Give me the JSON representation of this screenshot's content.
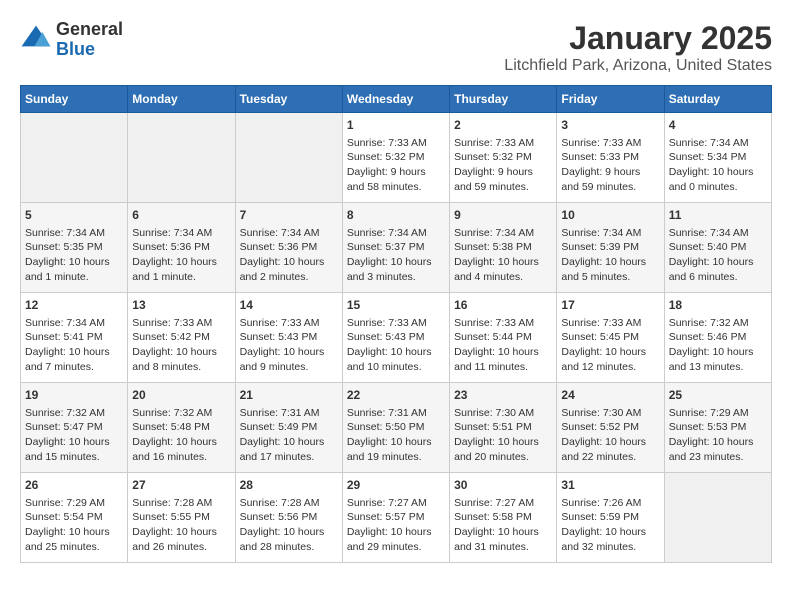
{
  "logo": {
    "general": "General",
    "blue": "Blue"
  },
  "title": "January 2025",
  "subtitle": "Litchfield Park, Arizona, United States",
  "days_of_week": [
    "Sunday",
    "Monday",
    "Tuesday",
    "Wednesday",
    "Thursday",
    "Friday",
    "Saturday"
  ],
  "weeks": [
    [
      {
        "day": "",
        "content": ""
      },
      {
        "day": "",
        "content": ""
      },
      {
        "day": "",
        "content": ""
      },
      {
        "day": "1",
        "content": "Sunrise: 7:33 AM\nSunset: 5:32 PM\nDaylight: 9 hours\nand 58 minutes."
      },
      {
        "day": "2",
        "content": "Sunrise: 7:33 AM\nSunset: 5:32 PM\nDaylight: 9 hours\nand 59 minutes."
      },
      {
        "day": "3",
        "content": "Sunrise: 7:33 AM\nSunset: 5:33 PM\nDaylight: 9 hours\nand 59 minutes."
      },
      {
        "day": "4",
        "content": "Sunrise: 7:34 AM\nSunset: 5:34 PM\nDaylight: 10 hours\nand 0 minutes."
      }
    ],
    [
      {
        "day": "5",
        "content": "Sunrise: 7:34 AM\nSunset: 5:35 PM\nDaylight: 10 hours\nand 1 minute."
      },
      {
        "day": "6",
        "content": "Sunrise: 7:34 AM\nSunset: 5:36 PM\nDaylight: 10 hours\nand 1 minute."
      },
      {
        "day": "7",
        "content": "Sunrise: 7:34 AM\nSunset: 5:36 PM\nDaylight: 10 hours\nand 2 minutes."
      },
      {
        "day": "8",
        "content": "Sunrise: 7:34 AM\nSunset: 5:37 PM\nDaylight: 10 hours\nand 3 minutes."
      },
      {
        "day": "9",
        "content": "Sunrise: 7:34 AM\nSunset: 5:38 PM\nDaylight: 10 hours\nand 4 minutes."
      },
      {
        "day": "10",
        "content": "Sunrise: 7:34 AM\nSunset: 5:39 PM\nDaylight: 10 hours\nand 5 minutes."
      },
      {
        "day": "11",
        "content": "Sunrise: 7:34 AM\nSunset: 5:40 PM\nDaylight: 10 hours\nand 6 minutes."
      }
    ],
    [
      {
        "day": "12",
        "content": "Sunrise: 7:34 AM\nSunset: 5:41 PM\nDaylight: 10 hours\nand 7 minutes."
      },
      {
        "day": "13",
        "content": "Sunrise: 7:33 AM\nSunset: 5:42 PM\nDaylight: 10 hours\nand 8 minutes."
      },
      {
        "day": "14",
        "content": "Sunrise: 7:33 AM\nSunset: 5:43 PM\nDaylight: 10 hours\nand 9 minutes."
      },
      {
        "day": "15",
        "content": "Sunrise: 7:33 AM\nSunset: 5:43 PM\nDaylight: 10 hours\nand 10 minutes."
      },
      {
        "day": "16",
        "content": "Sunrise: 7:33 AM\nSunset: 5:44 PM\nDaylight: 10 hours\nand 11 minutes."
      },
      {
        "day": "17",
        "content": "Sunrise: 7:33 AM\nSunset: 5:45 PM\nDaylight: 10 hours\nand 12 minutes."
      },
      {
        "day": "18",
        "content": "Sunrise: 7:32 AM\nSunset: 5:46 PM\nDaylight: 10 hours\nand 13 minutes."
      }
    ],
    [
      {
        "day": "19",
        "content": "Sunrise: 7:32 AM\nSunset: 5:47 PM\nDaylight: 10 hours\nand 15 minutes."
      },
      {
        "day": "20",
        "content": "Sunrise: 7:32 AM\nSunset: 5:48 PM\nDaylight: 10 hours\nand 16 minutes."
      },
      {
        "day": "21",
        "content": "Sunrise: 7:31 AM\nSunset: 5:49 PM\nDaylight: 10 hours\nand 17 minutes."
      },
      {
        "day": "22",
        "content": "Sunrise: 7:31 AM\nSunset: 5:50 PM\nDaylight: 10 hours\nand 19 minutes."
      },
      {
        "day": "23",
        "content": "Sunrise: 7:30 AM\nSunset: 5:51 PM\nDaylight: 10 hours\nand 20 minutes."
      },
      {
        "day": "24",
        "content": "Sunrise: 7:30 AM\nSunset: 5:52 PM\nDaylight: 10 hours\nand 22 minutes."
      },
      {
        "day": "25",
        "content": "Sunrise: 7:29 AM\nSunset: 5:53 PM\nDaylight: 10 hours\nand 23 minutes."
      }
    ],
    [
      {
        "day": "26",
        "content": "Sunrise: 7:29 AM\nSunset: 5:54 PM\nDaylight: 10 hours\nand 25 minutes."
      },
      {
        "day": "27",
        "content": "Sunrise: 7:28 AM\nSunset: 5:55 PM\nDaylight: 10 hours\nand 26 minutes."
      },
      {
        "day": "28",
        "content": "Sunrise: 7:28 AM\nSunset: 5:56 PM\nDaylight: 10 hours\nand 28 minutes."
      },
      {
        "day": "29",
        "content": "Sunrise: 7:27 AM\nSunset: 5:57 PM\nDaylight: 10 hours\nand 29 minutes."
      },
      {
        "day": "30",
        "content": "Sunrise: 7:27 AM\nSunset: 5:58 PM\nDaylight: 10 hours\nand 31 minutes."
      },
      {
        "day": "31",
        "content": "Sunrise: 7:26 AM\nSunset: 5:59 PM\nDaylight: 10 hours\nand 32 minutes."
      },
      {
        "day": "",
        "content": ""
      }
    ]
  ]
}
